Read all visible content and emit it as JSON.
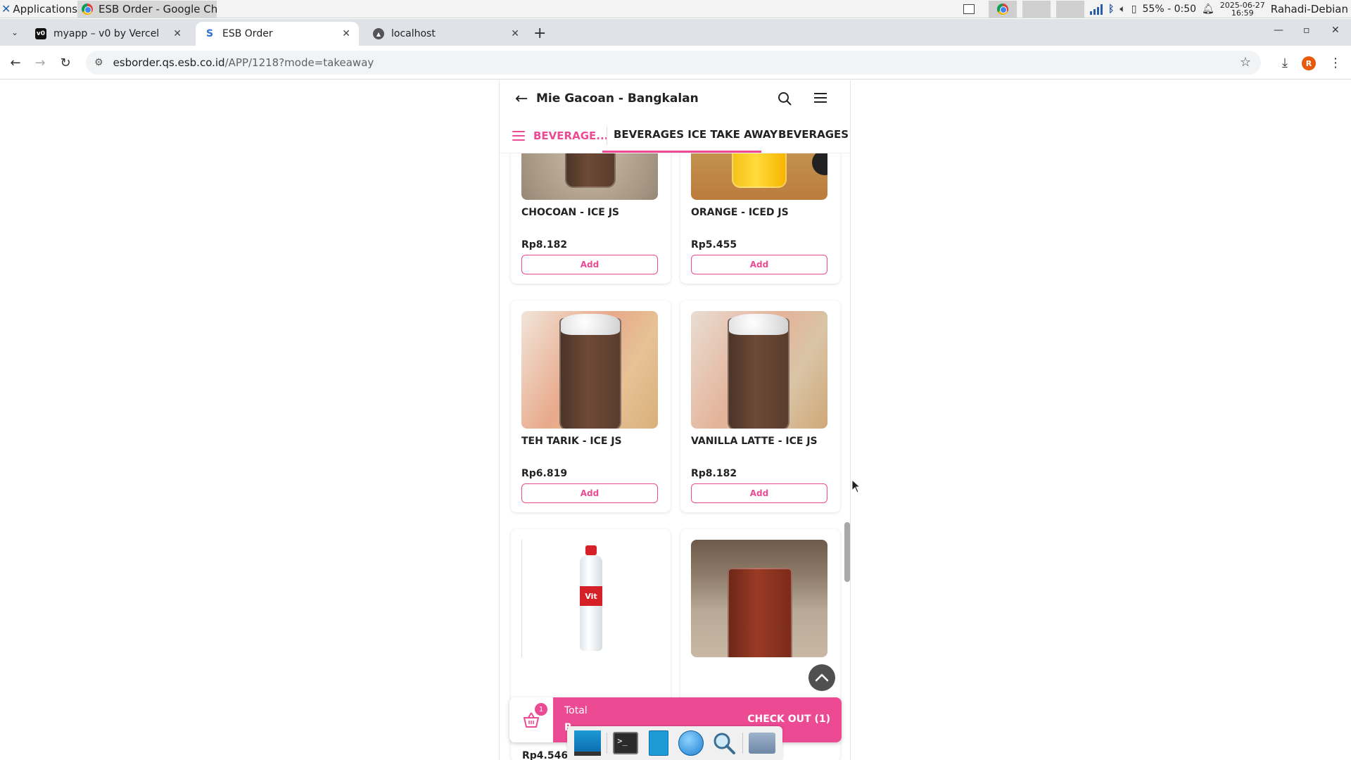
{
  "system_bar": {
    "applications_label": "Applications",
    "task_title": "ESB Order - Google Chr...",
    "battery": "55% - 0:50",
    "date": "2025-06-27",
    "time": "16:59",
    "user": "Rahadi-Debian"
  },
  "browser": {
    "tabs": [
      {
        "label": "myapp – v0 by Vercel",
        "favicon": "vercel-icon",
        "active": false
      },
      {
        "label": "ESB Order",
        "favicon": "esb-icon",
        "active": true
      },
      {
        "label": "localhost",
        "favicon": "globe-icon",
        "active": false
      }
    ],
    "url_host": "esborder.qs.esb.co.id",
    "url_path": "/APP/1218?mode=takeaway",
    "profile_initial": "R"
  },
  "app": {
    "store_name": "Mie Gacoan - Bangkalan",
    "categories": [
      "BEVERAGE...",
      "BEVERAGES ICE TAKE AWAY",
      "BEVERAGES HO"
    ],
    "active_category": "BEVERAGES ICE TAKE AWAY",
    "accent_color": "#ec4a93",
    "products": [
      {
        "name": "CHOCOAN - ICE JS",
        "price": "Rp8.182",
        "add_label": "Add"
      },
      {
        "name": "ORANGE - ICED JS",
        "price": "Rp5.455",
        "add_label": "Add"
      },
      {
        "name": "TEH TARIK - ICE JS",
        "price": "Rp6.819",
        "add_label": "Add"
      },
      {
        "name": "VANILLA LATTE - ICE JS",
        "price": "Rp8.182",
        "add_label": "Add"
      },
      {
        "name": "",
        "price": "Rp4.546",
        "bottle_label": "Vit"
      },
      {
        "name": "",
        "price": ""
      }
    ],
    "cart": {
      "count": "1",
      "total_label": "Total",
      "total_value": "R",
      "checkout_label": "CHECK OUT (1)"
    }
  }
}
